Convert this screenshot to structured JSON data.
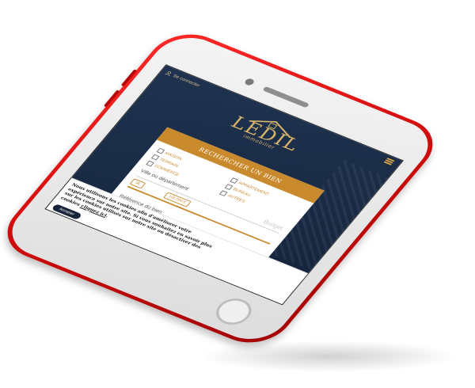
{
  "header": {
    "login_label": "Se connecter",
    "logo_title": "LEDIL",
    "logo_subtitle": "immobilier"
  },
  "search": {
    "title": "RECHERCHER UN BIEN",
    "types": [
      {
        "label": "MAISON"
      },
      {
        "label": "APPARTEMENT"
      },
      {
        "label": "TERRAIN"
      },
      {
        "label": "BUREAU"
      },
      {
        "label": "COMMERCE"
      },
      {
        "label": "AUTRES"
      }
    ],
    "location_label": "Ville ou département",
    "budget_label": "Budget",
    "price_min": "0€",
    "price_max": "100 000 €",
    "reference_label": "Référence du bien"
  },
  "cookie": {
    "text_start": "Nous utilisons les cookies afin d'améliorer votre expérience sur notre site. Si vous souhaitez en savoir plus sur les cookies utilisés sur notre site ou désactiver des cookies ",
    "link_text": "cliquez ici",
    "text_end": ".",
    "accept_label": "Accepter"
  },
  "colors": {
    "phone_body": "#d40d0d",
    "navy": "#1f3350",
    "gold": "#c88a2c"
  }
}
